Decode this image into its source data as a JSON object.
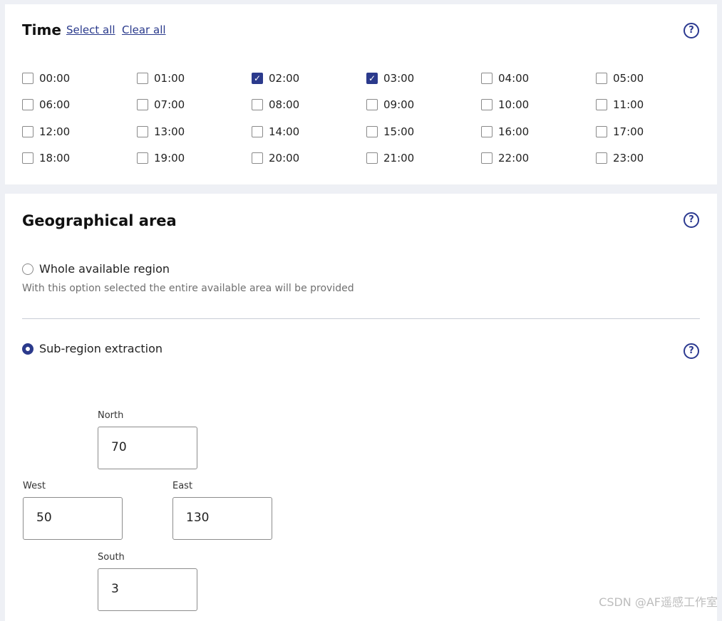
{
  "time": {
    "title": "Time",
    "select_all": "Select all",
    "clear_all": "Clear all",
    "help_icon": "?",
    "hours": [
      {
        "label": "00:00",
        "checked": false
      },
      {
        "label": "01:00",
        "checked": false
      },
      {
        "label": "02:00",
        "checked": true
      },
      {
        "label": "03:00",
        "checked": true
      },
      {
        "label": "04:00",
        "checked": false
      },
      {
        "label": "05:00",
        "checked": false
      },
      {
        "label": "06:00",
        "checked": false
      },
      {
        "label": "07:00",
        "checked": false
      },
      {
        "label": "08:00",
        "checked": false
      },
      {
        "label": "09:00",
        "checked": false
      },
      {
        "label": "10:00",
        "checked": false
      },
      {
        "label": "11:00",
        "checked": false
      },
      {
        "label": "12:00",
        "checked": false
      },
      {
        "label": "13:00",
        "checked": false
      },
      {
        "label": "14:00",
        "checked": false
      },
      {
        "label": "15:00",
        "checked": false
      },
      {
        "label": "16:00",
        "checked": false
      },
      {
        "label": "17:00",
        "checked": false
      },
      {
        "label": "18:00",
        "checked": false
      },
      {
        "label": "19:00",
        "checked": false
      },
      {
        "label": "20:00",
        "checked": false
      },
      {
        "label": "21:00",
        "checked": false
      },
      {
        "label": "22:00",
        "checked": false
      },
      {
        "label": "23:00",
        "checked": false
      }
    ]
  },
  "geo": {
    "title": "Geographical area",
    "help_icon": "?",
    "whole_region": {
      "label": "Whole available region",
      "description": "With this option selected the entire available area will be provided",
      "selected": false
    },
    "sub_region": {
      "label": "Sub-region extraction",
      "selected": true,
      "help_icon": "?"
    },
    "coords": {
      "north": {
        "label": "North",
        "value": "70"
      },
      "west": {
        "label": "West",
        "value": "50"
      },
      "east": {
        "label": "East",
        "value": "130"
      },
      "south": {
        "label": "South",
        "value": "3"
      }
    }
  },
  "watermark": "CSDN @AF遥感工作室",
  "colors": {
    "accent": "#2b3a8c",
    "panel_bg": "#ffffff",
    "page_bg": "#eef0f5"
  }
}
